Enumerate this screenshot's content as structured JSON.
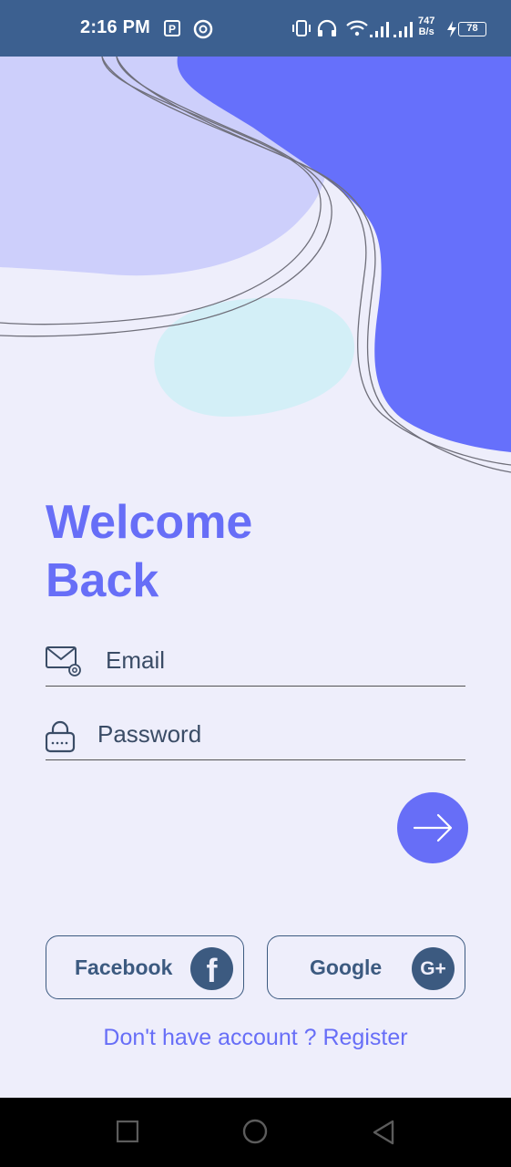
{
  "status_bar": {
    "time": "2:16 PM",
    "net_speed_value": "747",
    "net_speed_unit": "B/s",
    "battery_level": "78",
    "icons": [
      "parking-app-icon",
      "at-sign-icon",
      "vibrate-icon",
      "headphones-icon",
      "wifi-icon",
      "signal-icon",
      "signal-icon",
      "charging-icon",
      "battery-icon"
    ]
  },
  "login": {
    "title_line1": "Welcome",
    "title_line2": "Back",
    "email_placeholder": "Email",
    "password_placeholder": "Password"
  },
  "social": {
    "facebook_label": "Facebook",
    "facebook_glyph": "f",
    "google_label": "Google",
    "google_glyph": "G+"
  },
  "register_text": "Don't have account ? Register",
  "colors": {
    "accent": "#676ef7",
    "status_bar": "#3c6090",
    "background": "#eeeefb",
    "lavender_blob": "#cdcffb",
    "blue_blob": "#6670fb",
    "cyan_blob": "#d3eff7",
    "dark_text": "#3c5a80"
  }
}
